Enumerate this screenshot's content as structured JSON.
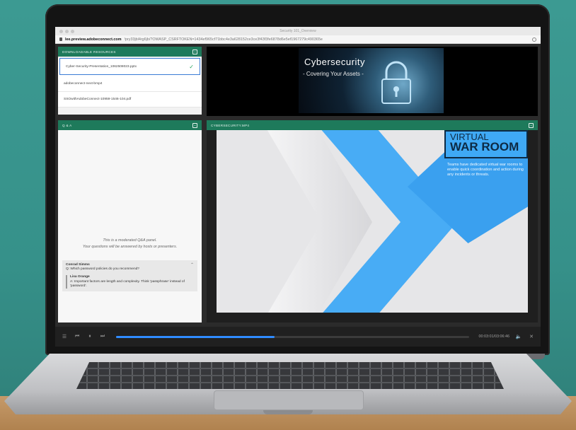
{
  "browser": {
    "window_title": "Security 101_Overview",
    "url_domain": "lee.preview.adobeconnect.com",
    "url_rest": "/pry33jbl4rg6jb/?OWASP_CSRFTOKEN=1434ef965cf71bbc4e3a628152ce3ce3f43f3fe6878d6e5ef1967279c490365e"
  },
  "resources": {
    "header": "DOWNLOADABLE RESOURCES",
    "items": [
      {
        "label": "Cyber-Security-Presentation_1062508023.pptx",
        "selected": true
      },
      {
        "label": "adobeconnect-next-bmp4",
        "selected": false
      },
      {
        "label": "SSOwithAdobeConnect-10959-1546-104.pdf",
        "selected": false
      }
    ]
  },
  "qa": {
    "header": "Q & A",
    "note_line1": "This is a moderated Q&A panel.",
    "note_line2": "Your questions will be answered by hosts or presenters.",
    "question_author": "Conrad Simms",
    "question_text": "Q: Which password policies do you recommend?",
    "answer_author": "Lisa Orange",
    "answer_text": "A: Important factors are length and complexity. Think 'passphrase' instead of 'password'."
  },
  "banner": {
    "title": "Cybersecurity",
    "subtitle": "- Covering Your Assets -"
  },
  "video": {
    "header": "CYBERSECURITY.MP4",
    "slide_title_line1": "VIRTUAL",
    "slide_title_line2": "WAR ROOM",
    "slide_desc": "Teams have dedicated virtual war rooms to enable quick coordination and action during any incidents or threats.",
    "progress": 0.45,
    "time": "00:03:01/03:06:46"
  },
  "colors": {
    "pod_header": "#1e7a5b",
    "accent_blue": "#3fa9f5",
    "progress": "#2f8cff"
  }
}
